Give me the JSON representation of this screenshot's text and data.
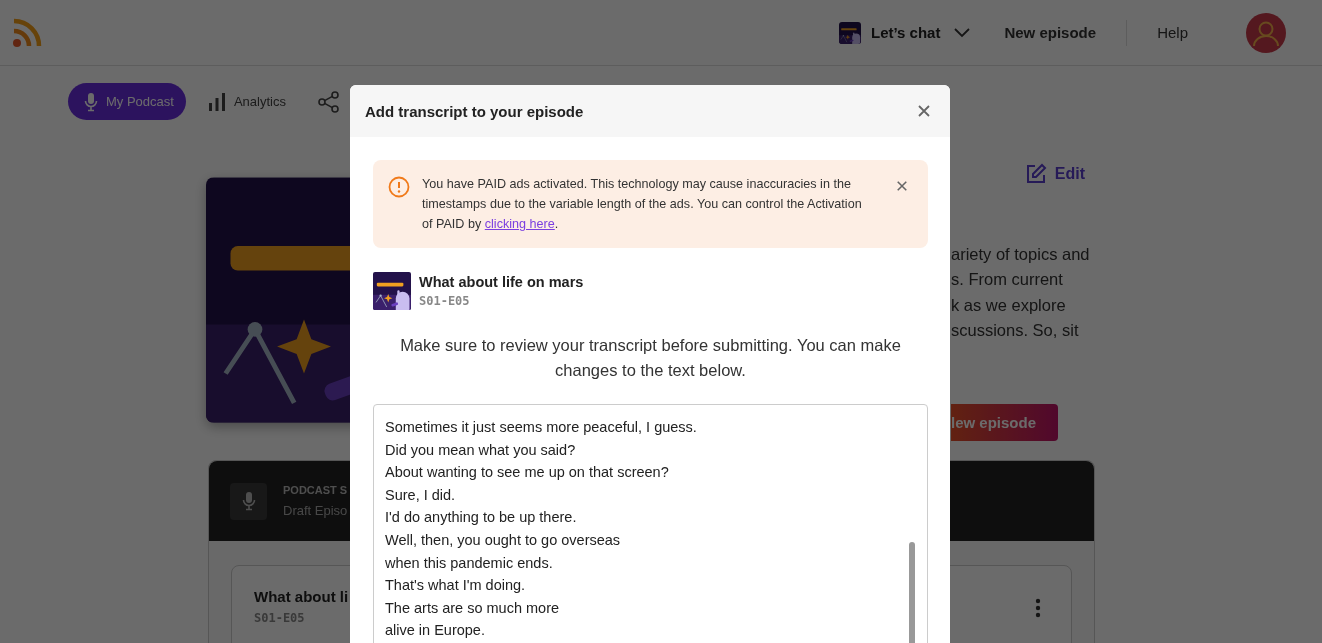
{
  "header": {
    "podcast_switcher": {
      "label": "Let’s chat"
    },
    "new_episode": "New episode",
    "help": "Help"
  },
  "nav": [
    {
      "label": "My Podcast",
      "selected": true
    },
    {
      "label": "Analytics",
      "selected": false
    }
  ],
  "podcast": {
    "edit": "Edit",
    "description_lines": [
      "ariety of topics and",
      "s. From current",
      "k as we explore",
      "scussions. So, sit"
    ],
    "new_episode_button": "lew episode"
  },
  "episodes_panel": {
    "heading": "PODCAST S",
    "subheading": "Draft Episo",
    "episode": {
      "title": "What about li",
      "code": "S01-E05"
    }
  },
  "modal": {
    "title": "Add transcript to your episode",
    "alert": {
      "text": "You have PAID ads activated. This technology may cause inaccuracies in the timestamps due to the variable length of the ads. You can control the Activation of PAID by ",
      "link": "clicking here",
      "text_end": "."
    },
    "episode": {
      "title": "What about life on mars",
      "code": "S01-E05"
    },
    "instructions": "Make sure to review your transcript before submitting. You can make changes to the text below.",
    "transcript": {
      "lines": [
        "Sometimes it just seems more peaceful, I guess.",
        "Did you mean what you said?",
        "About wanting to see me up on that screen?",
        "Sure, I did.",
        "I'd do anything to be up there.",
        "Well, then, you ought to go overseas",
        "when this pandemic ends.",
        "That's what I'm doing.",
        "The arts are so much more",
        "alive in Europe."
      ]
    }
  }
}
